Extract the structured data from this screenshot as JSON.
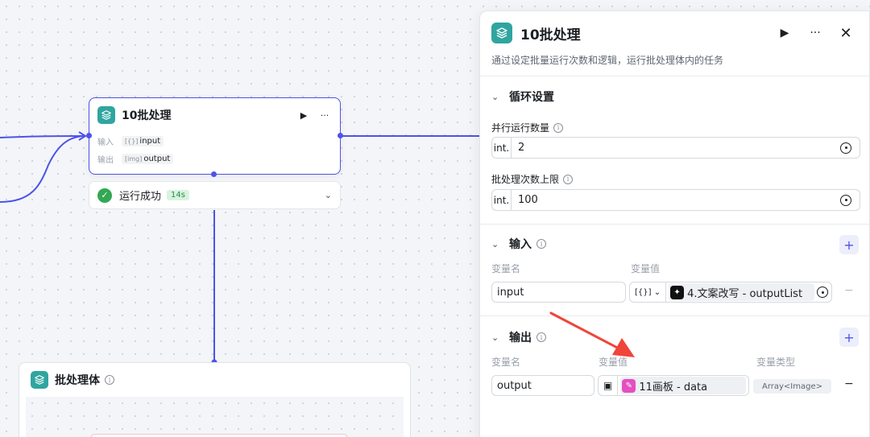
{
  "node": {
    "title": "10批处理",
    "input_label": "输入",
    "input_type": "[{}]",
    "input_value": "input",
    "output_label": "输出",
    "output_type": "[img]",
    "output_value": "output",
    "run_icon": "play-icon",
    "more_icon": "more-icon"
  },
  "status": {
    "text": "运行成功",
    "duration": "14s"
  },
  "batch_body": {
    "title": "批处理体"
  },
  "panel": {
    "title": "10批处理",
    "description": "通过设定批量运行次数和逻辑，运行批处理体内的任务",
    "loop_section": {
      "title": "循环设置",
      "parallel_label": "并行运行数量",
      "parallel_type": "int.",
      "parallel_value": "2",
      "limit_label": "批处理次数上限",
      "limit_type": "int.",
      "limit_value": "100"
    },
    "input_section": {
      "title": "输入",
      "col_name": "变量名",
      "col_value": "变量值",
      "var_name": "input",
      "ref_type": "[{}]",
      "ref_value": "4.文案改写 - outputList"
    },
    "output_section": {
      "title": "输出",
      "col_name": "变量名",
      "col_value": "变量值",
      "col_type": "变量类型",
      "var_name": "output",
      "ref_value": "11画板 - data",
      "var_type": "Array<Image>"
    }
  },
  "colors": {
    "accent": "#4d53e8",
    "node_icon": "#30a5a0",
    "success": "#32a853",
    "arrow": "#f0453a"
  }
}
